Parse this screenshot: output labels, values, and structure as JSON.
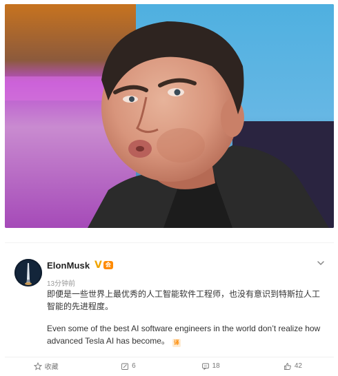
{
  "post": {
    "username": "ElonMusk",
    "verified_badge": "V",
    "member_badge": "会",
    "timestamp": "13分钟前",
    "text_zh": "即便是一些世界上最优秀的人工智能软件工程师，也没有意识到特斯拉人工智能的先进程度。",
    "text_en": "Even some of the best AI software engineers in the world don’t realize how advanced Tesla AI has become。",
    "translate_icon": "译"
  },
  "actions": {
    "favorite": {
      "label": "收藏",
      "icon": "star-icon"
    },
    "repost": {
      "count": "6",
      "icon": "repost-icon"
    },
    "comment": {
      "count": "18",
      "icon": "comment-icon"
    },
    "like": {
      "count": "42",
      "icon": "thumbs-up-icon"
    }
  },
  "colors": {
    "verified": "#f0a500",
    "accent": "#ff8a00",
    "muted": "#999999"
  }
}
